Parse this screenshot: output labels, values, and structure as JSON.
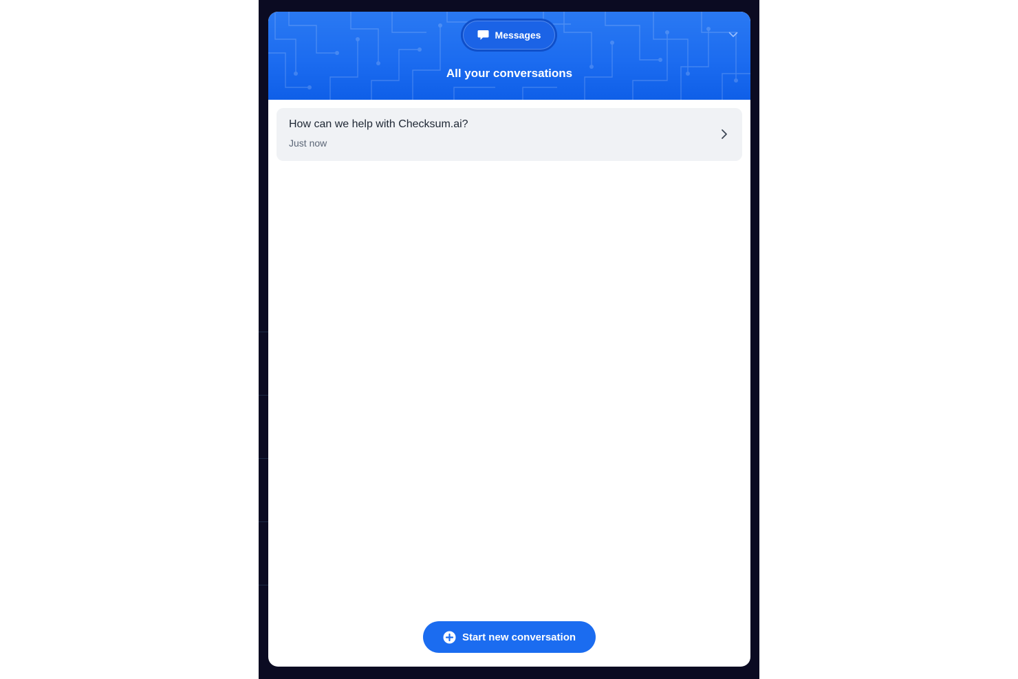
{
  "header": {
    "pill_label": "Messages",
    "title": "All your conversations",
    "pill_icon": "chat-bubble-icon",
    "collapse_icon": "chevron-down-icon"
  },
  "conversations": [
    {
      "title": "How can we help with Checksum.ai?",
      "time": "Just now"
    }
  ],
  "footer": {
    "start_label": "Start new conversation",
    "start_icon": "plus-circle-icon"
  },
  "colors": {
    "header_blue": "#1c6cf0",
    "button_blue": "#1b6cf0",
    "backdrop": "#0b0b22",
    "item_bg": "#f0f2f5"
  }
}
